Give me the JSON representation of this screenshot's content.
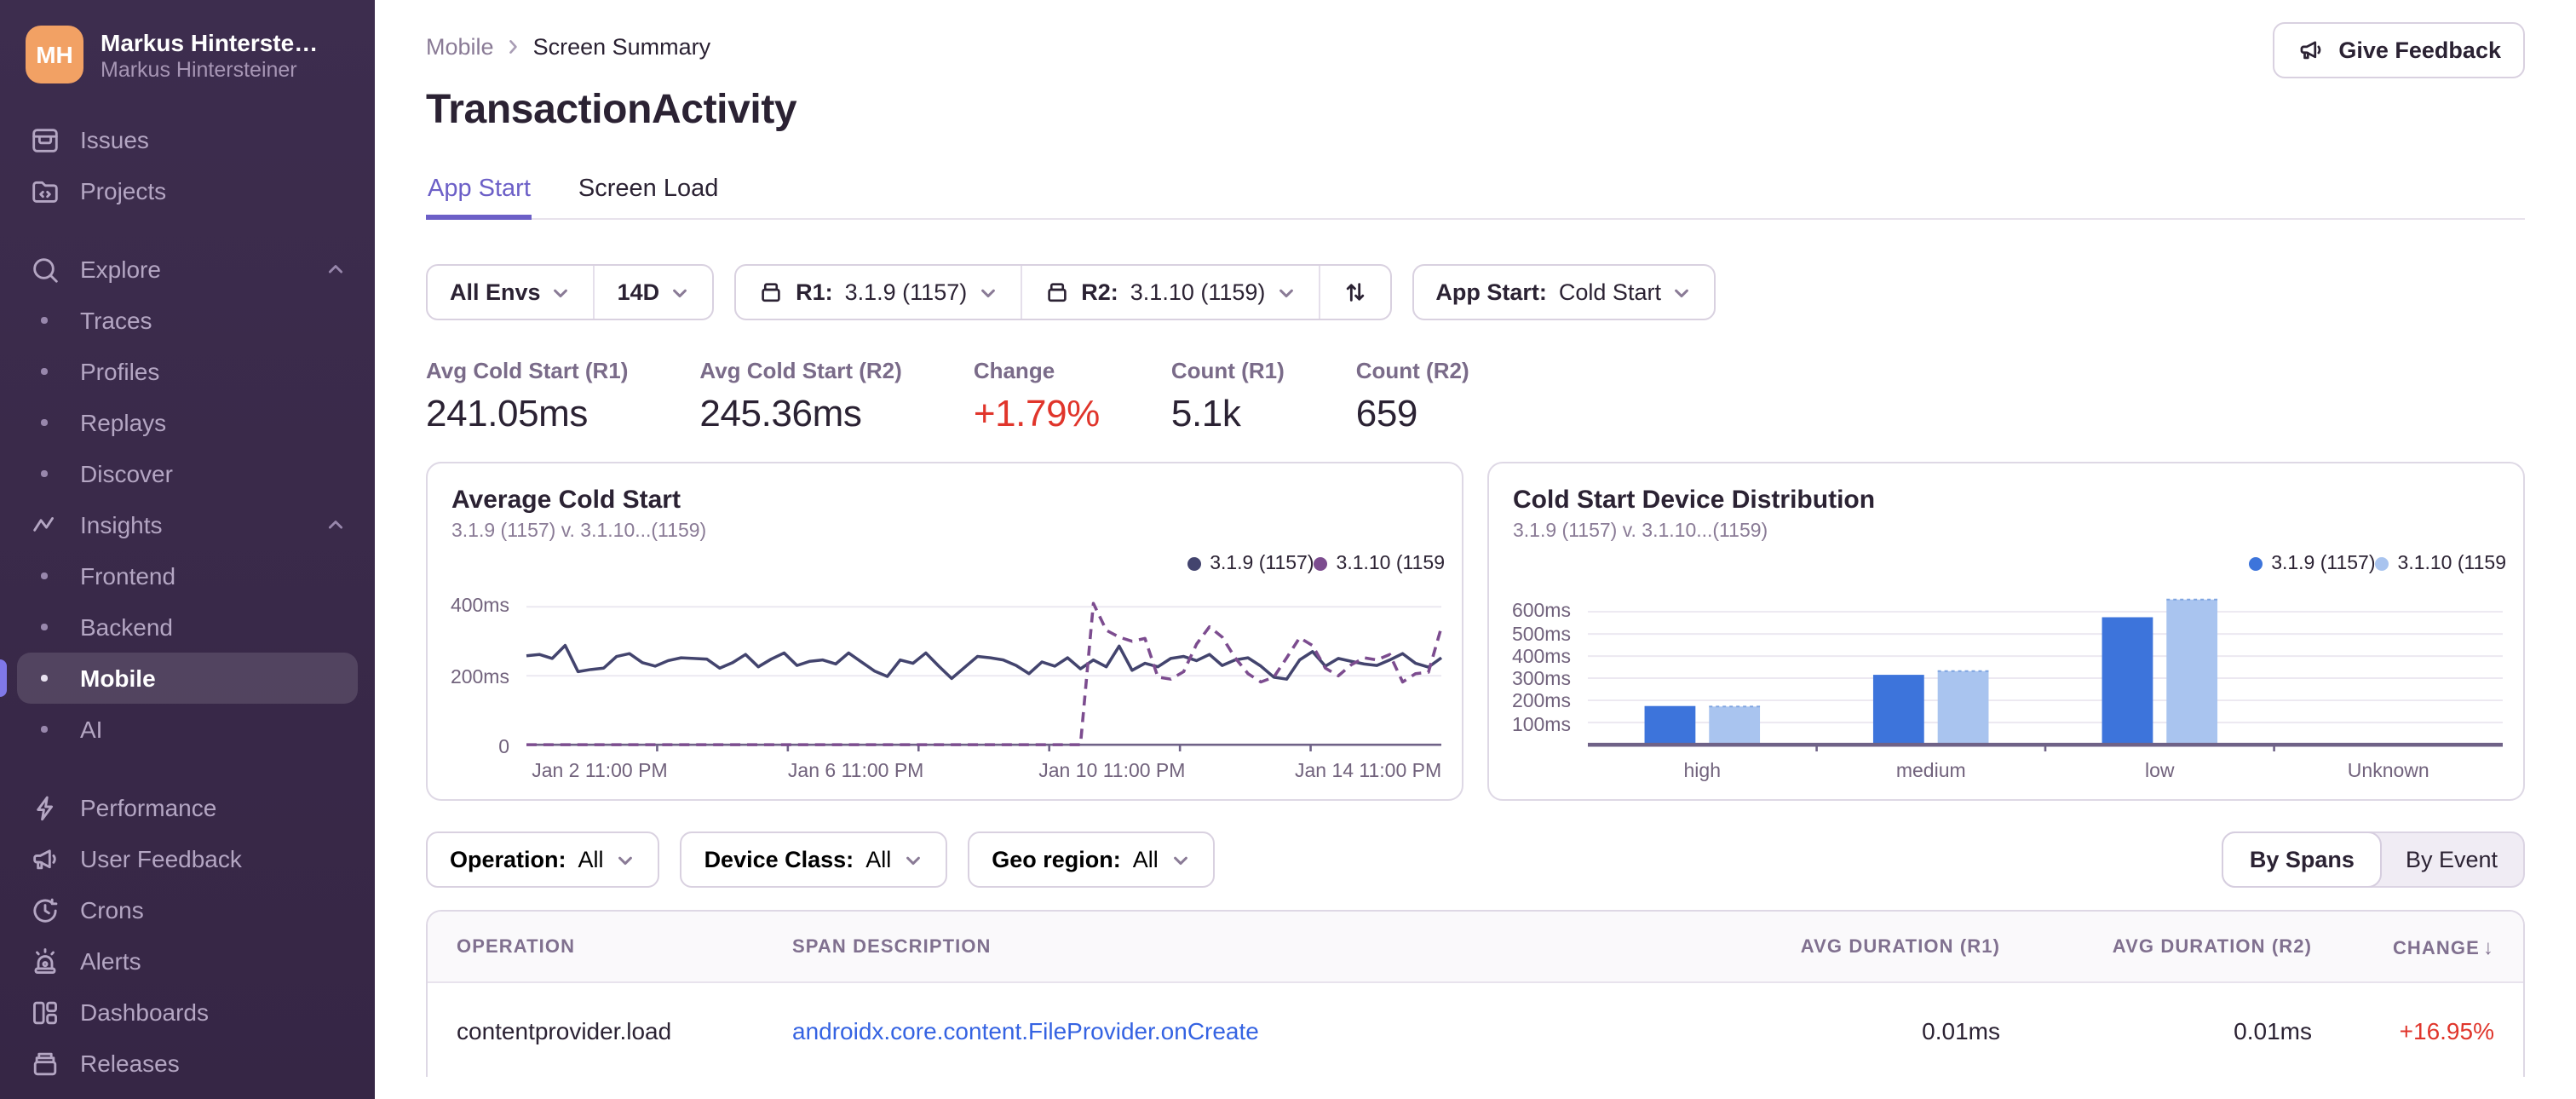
{
  "colors": {
    "accent_purple": "#6C5FC7",
    "negative_red": "#E0352B",
    "link_blue": "#3563E2",
    "line_r1": "#43446E",
    "line_r2": "#7C4C8F",
    "bar_r1": "#3D74DB",
    "bar_r2": "#A9C4EF",
    "sidebar_bg": "#3A2A49",
    "avatar_orange": "#F2A164"
  },
  "sidebar": {
    "user": {
      "initials": "MH",
      "name": "Markus Hintersteiner",
      "org": "Markus Hintersteiner"
    },
    "nav": [
      {
        "label": "Issues",
        "icon": "issues",
        "type": "item"
      },
      {
        "label": "Projects",
        "icon": "projects",
        "type": "item"
      },
      {
        "gap": true
      },
      {
        "label": "Explore",
        "icon": "search",
        "type": "section",
        "chevron": "up"
      },
      {
        "label": "Traces",
        "type": "child"
      },
      {
        "label": "Profiles",
        "type": "child"
      },
      {
        "label": "Replays",
        "type": "child"
      },
      {
        "label": "Discover",
        "type": "child"
      },
      {
        "label": "Insights",
        "icon": "insights",
        "type": "section",
        "chevron": "up"
      },
      {
        "label": "Frontend",
        "type": "child"
      },
      {
        "label": "Backend",
        "type": "child"
      },
      {
        "label": "Mobile",
        "type": "child",
        "active": true
      },
      {
        "label": "AI",
        "type": "child"
      },
      {
        "gap": true
      },
      {
        "label": "Performance",
        "icon": "performance",
        "type": "item"
      },
      {
        "label": "User Feedback",
        "icon": "megaphone",
        "type": "item"
      },
      {
        "label": "Crons",
        "icon": "crons",
        "type": "item"
      },
      {
        "label": "Alerts",
        "icon": "alerts",
        "type": "item"
      },
      {
        "label": "Dashboards",
        "icon": "dashboards",
        "type": "item"
      },
      {
        "label": "Releases",
        "icon": "releases",
        "type": "item"
      }
    ]
  },
  "breadcrumb": {
    "parent": "Mobile",
    "current": "Screen Summary"
  },
  "page_title": "TransactionActivity",
  "feedback_button": "Give Feedback",
  "tabs": [
    {
      "label": "App Start",
      "active": true
    },
    {
      "label": "Screen Load",
      "active": false
    }
  ],
  "filters": {
    "env": "All Envs",
    "date_range": "14D",
    "r1_label": "R1:",
    "r1_value": "3.1.9 (1157)",
    "r2_label": "R2:",
    "r2_value": "3.1.10 (1159)",
    "appstart_label": "App Start:",
    "appstart_value": "Cold Start"
  },
  "stats": [
    {
      "label": "Avg Cold Start (R1)",
      "value": "241.05ms"
    },
    {
      "label": "Avg Cold Start (R2)",
      "value": "245.36ms"
    },
    {
      "label": "Change",
      "value": "+1.79%",
      "color": "#E0352B"
    },
    {
      "label": "Count (R1)",
      "value": "5.1k"
    },
    {
      "label": "Count (R2)",
      "value": "659"
    }
  ],
  "chart_data": [
    {
      "type": "line",
      "title": "Average Cold Start",
      "subtitle": "3.1.9 (1157) v. 3.1.10...(1159)",
      "legend": [
        {
          "label": "3.1.9 (1157)",
          "color": "#43446E"
        },
        {
          "label": "3.1.10 (1159",
          "color": "#7C4C8F"
        }
      ],
      "ymax": 450,
      "y_ticks": [
        {
          "label": "400ms",
          "value": 400
        },
        {
          "label": "200ms",
          "value": 200
        },
        {
          "label": "0",
          "value": 0
        }
      ],
      "x_ticklabels": [
        {
          "label": "Jan 2 11:00 PM",
          "pos": 8
        },
        {
          "label": "Jan 6 11:00 PM",
          "pos": 36
        },
        {
          "label": "Jan 10 11:00 PM",
          "pos": 64
        },
        {
          "label": "Jan 14 11:00 PM",
          "pos": 92
        }
      ],
      "series": [
        {
          "name": "3.1.9 (1157)",
          "color": "#43446E",
          "dash": "solid",
          "values": [
            258,
            262,
            250,
            288,
            212,
            218,
            222,
            256,
            264,
            238,
            228,
            244,
            252,
            250,
            248,
            222,
            238,
            262,
            226,
            248,
            266,
            230,
            242,
            246,
            234,
            266,
            240,
            214,
            198,
            246,
            236,
            266,
            228,
            192,
            224,
            256,
            252,
            246,
            230,
            206,
            240,
            228,
            252,
            220,
            246,
            226,
            286,
            216,
            236,
            226,
            250,
            256,
            244,
            262,
            230,
            246,
            252,
            228,
            196,
            190,
            246,
            270,
            228,
            250,
            242,
            234,
            230,
            246,
            264,
            236,
            225,
            252
          ]
        },
        {
          "name": "3.1.10 (1159)",
          "color": "#7C4C8F",
          "dash": "dashed",
          "values": [
            0,
            0,
            0,
            0,
            0,
            0,
            0,
            0,
            0,
            0,
            0,
            0,
            0,
            0,
            0,
            0,
            0,
            0,
            0,
            0,
            0,
            0,
            0,
            0,
            0,
            0,
            0,
            0,
            0,
            0,
            0,
            0,
            0,
            0,
            0,
            0,
            0,
            0,
            0,
            0,
            0,
            0,
            0,
            0,
            410,
            332,
            312,
            300,
            308,
            196,
            190,
            212,
            292,
            342,
            312,
            252,
            206,
            182,
            196,
            252,
            310,
            288,
            222,
            200,
            232,
            252,
            246,
            262,
            182,
            206,
            210,
            340
          ]
        }
      ]
    },
    {
      "type": "bar",
      "title": "Cold Start Device Distribution",
      "subtitle": "3.1.9 (1157) v. 3.1.10...(1159)",
      "legend": [
        {
          "label": "3.1.9 (1157)",
          "color": "#3D74DB"
        },
        {
          "label": "3.1.10 (1159",
          "color": "#A9C4EF"
        }
      ],
      "ymax": 700,
      "y_ticks": [
        {
          "label": "600ms",
          "value": 600
        },
        {
          "label": "500ms",
          "value": 500
        },
        {
          "label": "400ms",
          "value": 400
        },
        {
          "label": "300ms",
          "value": 300
        },
        {
          "label": "200ms",
          "value": 200
        },
        {
          "label": "100ms",
          "value": 100
        }
      ],
      "categories": [
        "high",
        "medium",
        "low",
        "Unknown"
      ],
      "series": [
        {
          "name": "3.1.9 (1157)",
          "color": "#3D74DB",
          "values": [
            175,
            315,
            575,
            0
          ]
        },
        {
          "name": "3.1.10 (1159)",
          "color": "#A9C4EF",
          "values": [
            172,
            332,
            655,
            0
          ]
        }
      ]
    }
  ],
  "table_filters": [
    {
      "label": "Operation:",
      "value": "All"
    },
    {
      "label": "Device Class:",
      "value": "All"
    },
    {
      "label": "Geo region:",
      "value": "All"
    }
  ],
  "view_toggle": [
    {
      "label": "By Spans",
      "active": true
    },
    {
      "label": "By Event",
      "active": false
    }
  ],
  "table": {
    "columns": [
      {
        "label": "OPERATION",
        "align": "left"
      },
      {
        "label": "SPAN DESCRIPTION",
        "align": "left"
      },
      {
        "label": "AVG DURATION (R1)",
        "align": "right"
      },
      {
        "label": "AVG DURATION (R2)",
        "align": "right"
      },
      {
        "label": "CHANGE",
        "align": "right",
        "sort": "desc",
        "sort_glyph": "↓"
      }
    ],
    "rows": [
      {
        "operation": "contentprovider.load",
        "description": "androidx.core.content.FileProvider.onCreate",
        "r1": "0.01ms",
        "r2": "0.01ms",
        "change": "+16.95%"
      }
    ]
  }
}
